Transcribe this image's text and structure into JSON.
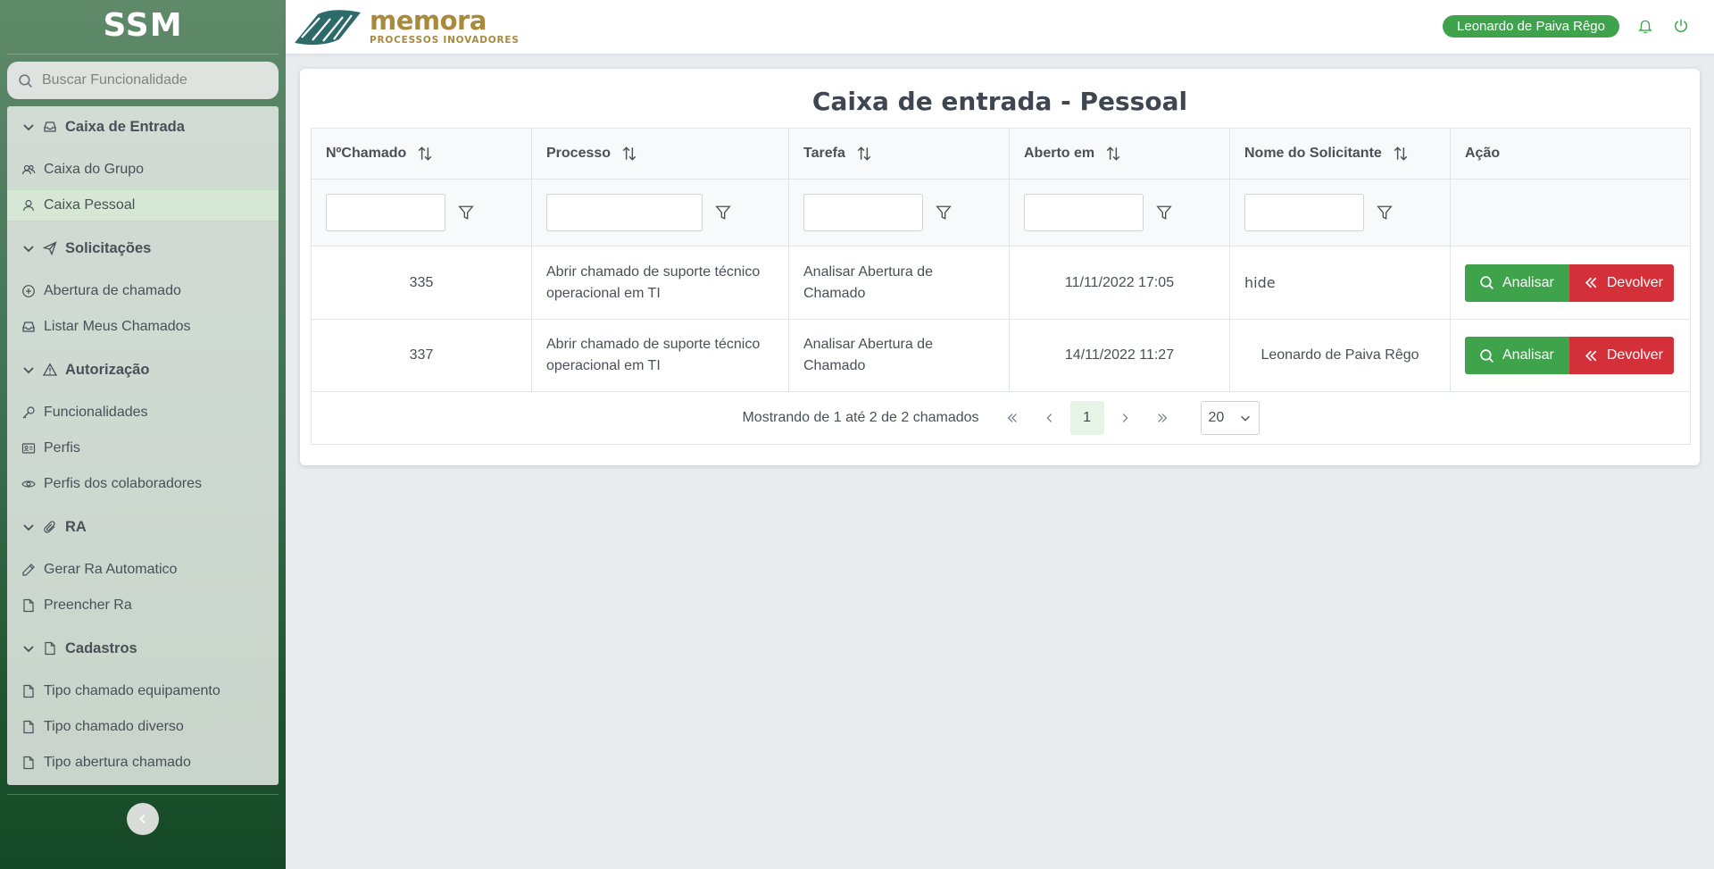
{
  "app": {
    "brand": "SSM"
  },
  "sidebar": {
    "search_placeholder": "Buscar Funcionalidade",
    "sections": [
      {
        "label": "Caixa de Entrada",
        "icon": "inbox-icon",
        "items": [
          {
            "label": "Caixa do Grupo",
            "icon": "users-icon"
          },
          {
            "label": "Caixa Pessoal",
            "icon": "user-icon",
            "active": true
          }
        ]
      },
      {
        "label": "Solicitações",
        "icon": "send-icon",
        "items": [
          {
            "label": "Abertura de chamado",
            "icon": "plus-circle-icon"
          },
          {
            "label": "Listar Meus Chamados",
            "icon": "inbox-icon"
          }
        ]
      },
      {
        "label": "Autorização",
        "icon": "warning-icon",
        "items": [
          {
            "label": "Funcionalidades",
            "icon": "key-icon"
          },
          {
            "label": "Perfis",
            "icon": "id-card-icon"
          },
          {
            "label": "Perfis dos colaboradores",
            "icon": "eye-icon"
          }
        ]
      },
      {
        "label": "RA",
        "icon": "paperclip-icon",
        "items": [
          {
            "label": "Gerar Ra Automatico",
            "icon": "pencil-icon"
          },
          {
            "label": "Preencher Ra",
            "icon": "file-icon"
          }
        ]
      },
      {
        "label": "Cadastros",
        "icon": "file-icon",
        "items": [
          {
            "label": "Tipo chamado equipamento",
            "icon": "file-icon"
          },
          {
            "label": "Tipo chamado diverso",
            "icon": "file-icon"
          },
          {
            "label": "Tipo abertura chamado",
            "icon": "file-icon"
          }
        ]
      }
    ]
  },
  "header": {
    "logo_main": "memora",
    "logo_sub": "PROCESSOS INOVADORES",
    "user_name": "Leonardo de Paiva Rêgo"
  },
  "page": {
    "title": "Caixa de entrada - Pessoal"
  },
  "table": {
    "columns": [
      "NºChamado",
      "Processo",
      "Tarefa",
      "Aberto em",
      "Nome do Solicitante",
      "Ação"
    ],
    "rows": [
      {
        "numero": "335",
        "processo": "Abrir chamado de suporte técnico operacional em TI",
        "tarefa": "Analisar Abertura de Chamado",
        "aberto_em": "11/11/2022 17:05",
        "solicitante": "hide"
      },
      {
        "numero": "337",
        "processo": "Abrir chamado de suporte técnico operacional em TI",
        "tarefa": "Analisar Abertura de Chamado",
        "aberto_em": "14/11/2022 11:27",
        "solicitante": "Leonardo de Paiva Rêgo"
      }
    ],
    "actions": {
      "analyze": "Analisar",
      "return": "Devolver"
    }
  },
  "pagination": {
    "summary": "Mostrando de 1 até 2 de 2 chamados",
    "current_page": "1",
    "page_size": "20"
  },
  "colors": {
    "accent": "#3ea34b",
    "danger": "#d3303a",
    "brand": "#a98a3c"
  }
}
